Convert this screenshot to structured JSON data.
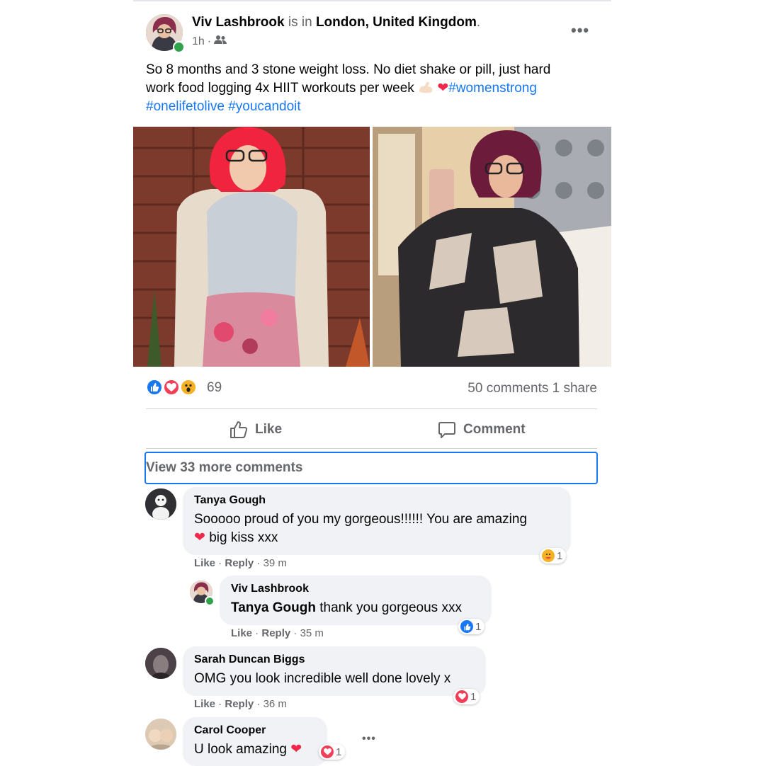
{
  "post": {
    "author": "Viv Lashbrook",
    "is_in": "is in",
    "location": "London, United Kingdom",
    "period": ".",
    "time": "1h",
    "dot": "·",
    "text_line1": "So 8 months and 3 stone weight loss. No diet shake or pill, just hard",
    "text_line2": "work food logging 4x HIIT workouts per week",
    "hashtag1": "#womenstrong",
    "hashtag2": "#onelifetolive",
    "hashtag3": "#youcandoit",
    "more_icon": "more-dots-icon"
  },
  "reactions": {
    "types": [
      "like",
      "love",
      "wow"
    ],
    "count": "69",
    "comments": "50 comments",
    "shares": "1 share"
  },
  "actions": {
    "like": "Like",
    "comment": "Comment"
  },
  "view_more": "View 33 more comments",
  "comments": [
    {
      "name": "Tanya Gough",
      "text_line1": "Sooooo proud of you my gorgeous!!!!!! You are amazing",
      "text_line2": "big kiss xxx",
      "like": "Like",
      "reply": "Reply",
      "time": "39 m",
      "reaction_count": "1",
      "reaction_type": "care"
    },
    {
      "name": "Viv Lashbrook",
      "mention": "Tanya Gough",
      "text": "thank you gorgeous xxx",
      "like": "Like",
      "reply": "Reply",
      "time": "35 m",
      "reaction_count": "1",
      "reaction_type": "like"
    },
    {
      "name": "Sarah Duncan Biggs",
      "text": "OMG you look incredible well done lovely x",
      "like": "Like",
      "reply": "Reply",
      "time": "36 m",
      "reaction_count": "1",
      "reaction_type": "love"
    },
    {
      "name": "Carol Cooper",
      "text": "U look amazing",
      "reaction_count": "1",
      "reaction_type": "love"
    }
  ],
  "colors": {
    "accent": "#1877f2",
    "muted": "#65676b",
    "love": "#f33e58",
    "online": "#31a24c"
  }
}
